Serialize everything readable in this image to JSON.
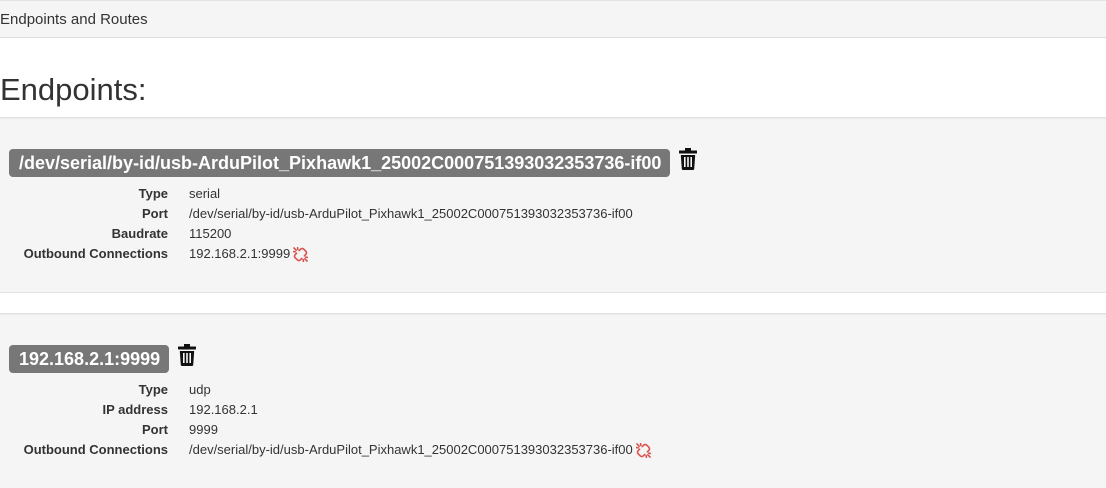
{
  "top_bar": {
    "title": "Endpoints and Routes"
  },
  "page_heading": "Endpoints:",
  "endpoints": [
    {
      "name": "/dev/serial/by-id/usb-ArduPilot_Pixhawk1_25002C000751393032353736-if00",
      "delete_icon": "trash-icon",
      "properties": [
        {
          "key": "Type",
          "value": "serial"
        },
        {
          "key": "Port",
          "value": "/dev/serial/by-id/usb-ArduPilot_Pixhawk1_25002C000751393032353736-if00"
        },
        {
          "key": "Baudrate",
          "value": "115200"
        },
        {
          "key": "Outbound Connections",
          "value": "192.168.2.1:9999"
        }
      ],
      "unlink_icon": "unlink-icon"
    },
    {
      "name": "192.168.2.1:9999",
      "delete_icon": "trash-icon",
      "properties": [
        {
          "key": "Type",
          "value": "udp"
        },
        {
          "key": "IP address",
          "value": "192.168.2.1"
        },
        {
          "key": "Port",
          "value": "9999"
        },
        {
          "key": "Outbound Connections",
          "value": "/dev/serial/by-id/usb-ArduPilot_Pixhawk1_25002C000751393032353736-if00"
        }
      ],
      "unlink_icon": "unlink-icon"
    }
  ],
  "colors": {
    "label_bg": "#777777",
    "well_bg": "#f5f5f5",
    "unlink_red": "#d9534f"
  }
}
